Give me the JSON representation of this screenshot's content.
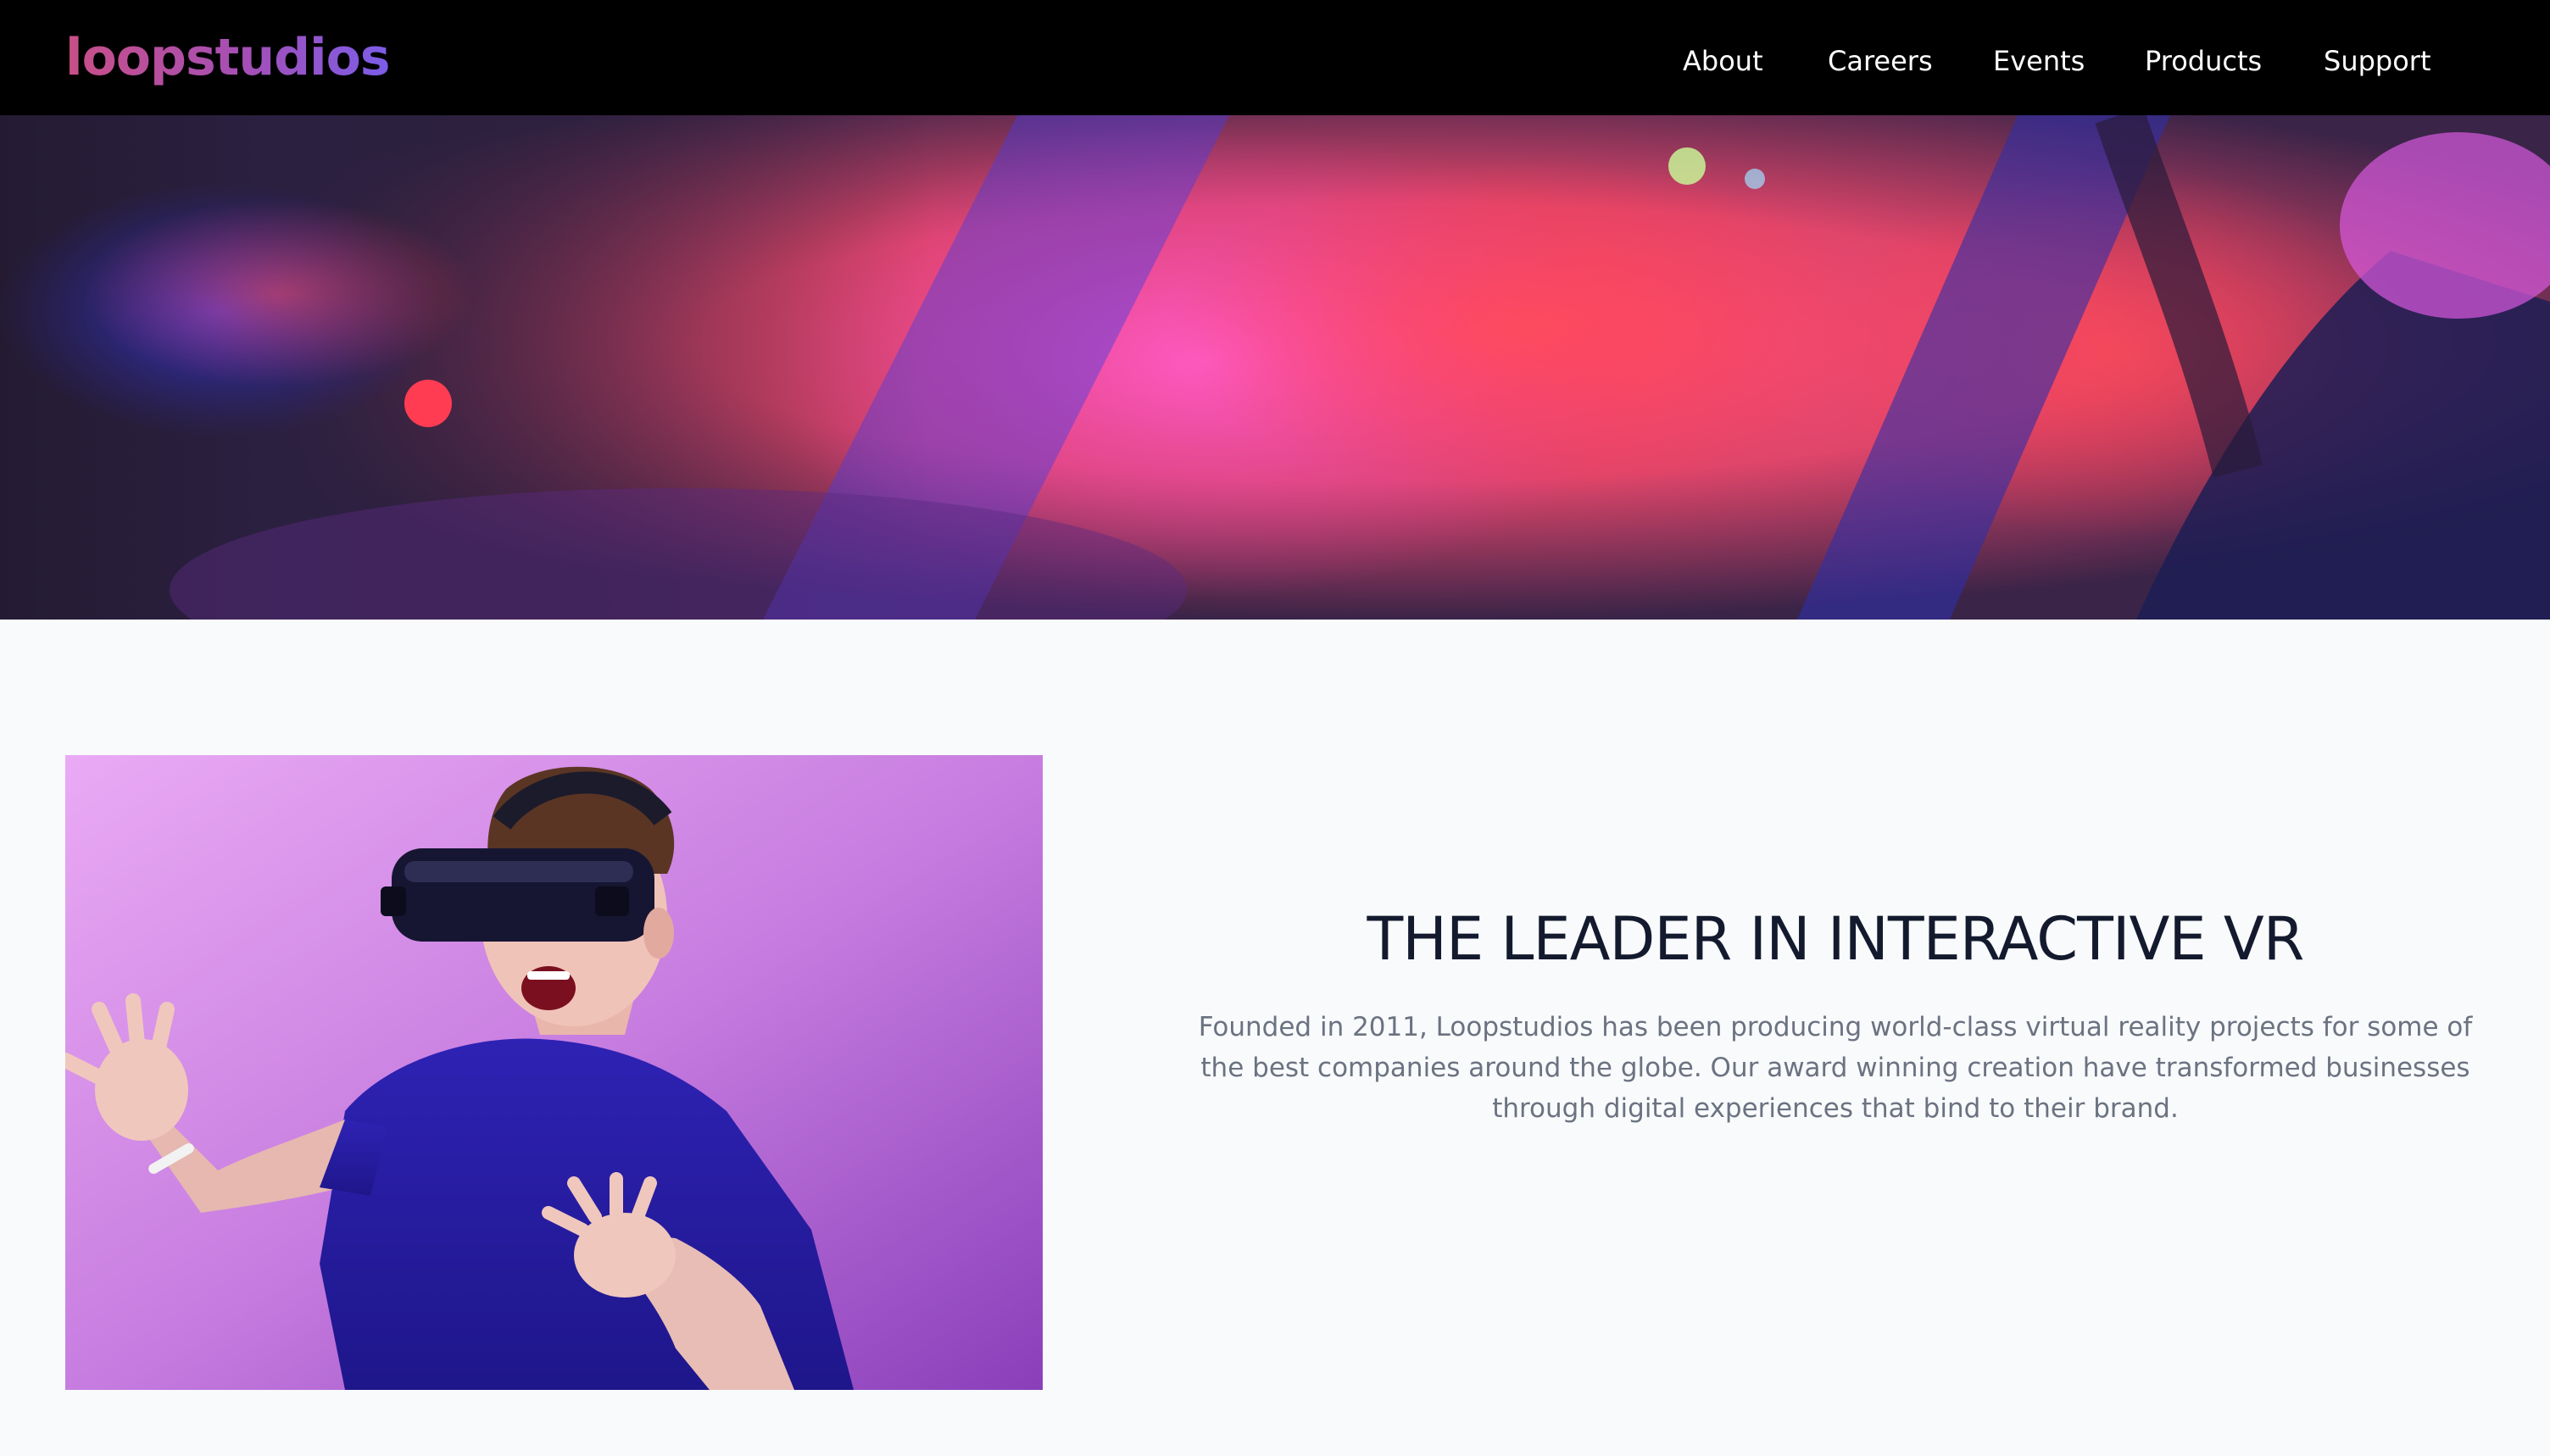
{
  "header": {
    "logo_text": "loopstudios",
    "nav": [
      {
        "label": "About"
      },
      {
        "label": "Careers"
      },
      {
        "label": "Events"
      },
      {
        "label": "Products"
      },
      {
        "label": "Support"
      }
    ]
  },
  "hero": {
    "image_name": "hero-vr-image"
  },
  "feature": {
    "image_name": "man-with-vr-headset-image",
    "title": "THE LEADER IN INTERACTIVE VR",
    "body": "Founded in 2011, Loopstudios has been producing world-class virtual reality projects for some of the best companies around the globe. Our award winning creation have transformed businesses through digital experiences that bind to their brand."
  },
  "colors": {
    "nav_background": "#000000",
    "page_background": "#f8fafc",
    "logo_gradient_start": "#c94f86",
    "logo_gradient_end": "#7b5de8",
    "title_color": "#141a2e",
    "body_color": "#6b7280"
  }
}
